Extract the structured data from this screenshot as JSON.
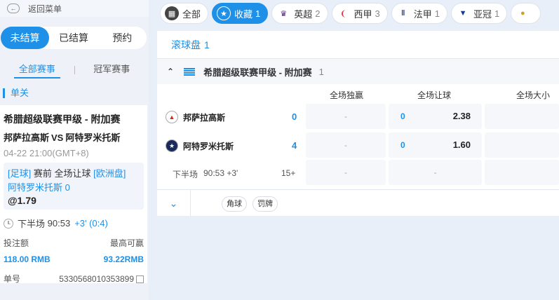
{
  "left": {
    "back_label": "返回菜单",
    "tabs": [
      "未结算",
      "已结算",
      "预约"
    ],
    "subtabs": [
      "全部赛事",
      "冠军赛事"
    ],
    "single_label": "单关",
    "bet": {
      "league": "希腊超级联赛甲级 - 附加赛",
      "home": "邦萨拉高斯",
      "vs": "VS",
      "away": "阿特罗米托斯",
      "time": "04-22 21:00(GMT+8)",
      "sport": "[足球]",
      "market": "赛前 全场让球",
      "odds_type": "[欧洲盘]",
      "selection": "阿特罗米托斯 0",
      "odds": "@1.79",
      "period": "下半场",
      "clock": "90:53",
      "extra": "+3' (0:4)",
      "stake_label": "投注额",
      "max_win_label": "最高可赢",
      "stake": "118.00 RMB",
      "max_win": "93.22RMB",
      "order_label": "单号",
      "order_no": "5330568010353899"
    }
  },
  "filters": [
    {
      "label": "全部",
      "count": "",
      "icon": "grid-icon",
      "active": false
    },
    {
      "label": "收藏",
      "count": "1",
      "icon": "star-icon",
      "active": true
    },
    {
      "label": "英超",
      "count": "2",
      "icon": "premier-league-icon",
      "active": false
    },
    {
      "label": "西甲",
      "count": "3",
      "icon": "laliga-icon",
      "active": false
    },
    {
      "label": "法甲",
      "count": "1",
      "icon": "ligue1-icon",
      "active": false
    },
    {
      "label": "亚冠",
      "count": "1",
      "icon": "afc-cup-icon",
      "active": false
    }
  ],
  "main": {
    "live_label": "滚球盘",
    "live_count": "1",
    "league": "希腊超级联赛甲级 - 附加赛",
    "league_count": "1",
    "col_headers": [
      "全场独赢",
      "全场让球",
      "全场大小"
    ],
    "teams": [
      {
        "name": "邦萨拉高斯",
        "score": "0",
        "win": "-",
        "hcp": "0",
        "hcp_odds": "2.38"
      },
      {
        "name": "阿特罗米托斯",
        "score": "4",
        "win": "-",
        "hcp": "0",
        "hcp_odds": "1.60"
      }
    ],
    "half": {
      "label": "下半场",
      "time": "90:53 +3'",
      "more": "15+",
      "c1": "-",
      "c2": "-"
    },
    "tags": [
      "角球",
      "罚牌"
    ],
    "colors": {
      "accent": "#1e90e8"
    }
  }
}
